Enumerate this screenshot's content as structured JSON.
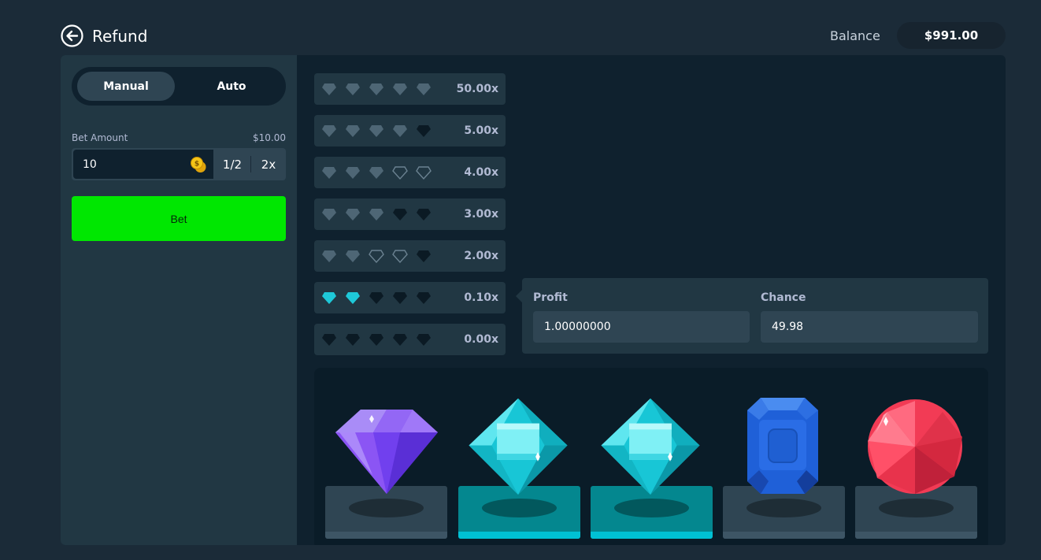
{
  "header": {
    "refund_label": "Refund",
    "balance_label": "Balance",
    "balance_value": "$991.00"
  },
  "sidebar": {
    "modes": [
      "Manual",
      "Auto"
    ],
    "active_mode": "Manual",
    "bet_amount_label": "Bet Amount",
    "bet_amount_usd": "$10.00",
    "bet_value": "10",
    "half_label": "1/2",
    "double_label": "2x",
    "bet_button": "Bet"
  },
  "paytable": [
    {
      "multiplier": "50.00x",
      "gems": [
        "dim",
        "dim",
        "dim",
        "dim",
        "dim"
      ]
    },
    {
      "multiplier": "5.00x",
      "gems": [
        "dim",
        "dim",
        "dim",
        "dim",
        "dark"
      ]
    },
    {
      "multiplier": "4.00x",
      "gems": [
        "dim",
        "dim",
        "dim",
        "outline",
        "outline"
      ]
    },
    {
      "multiplier": "3.00x",
      "gems": [
        "dim",
        "dim",
        "dim",
        "dark",
        "dark"
      ]
    },
    {
      "multiplier": "2.00x",
      "gems": [
        "dim",
        "dim",
        "outline",
        "outline",
        "dark"
      ]
    },
    {
      "multiplier": "0.10x",
      "gems": [
        "cyan",
        "cyan",
        "dark",
        "dark",
        "dark"
      ]
    },
    {
      "multiplier": "0.00x",
      "gems": [
        "dark",
        "dark",
        "dark",
        "dark",
        "dark"
      ]
    }
  ],
  "info": {
    "profit_label": "Profit",
    "profit_value": "1.00000000",
    "chance_label": "Chance",
    "chance_value": "49.98"
  },
  "board": [
    {
      "gem": "purple-diamond",
      "matched": false
    },
    {
      "gem": "cyan-octahedron",
      "matched": true
    },
    {
      "gem": "cyan-octahedron",
      "matched": true
    },
    {
      "gem": "blue-emerald",
      "matched": false
    },
    {
      "gem": "red-round-gem",
      "matched": false
    }
  ],
  "colors": {
    "background": "#1b2b38",
    "panel": "#213743",
    "card": "#0f212e",
    "accent_green": "#00e701",
    "match_teal": "#04878f",
    "match_bar": "#00c1d4",
    "gem_cyan": "#1ec8d8"
  }
}
